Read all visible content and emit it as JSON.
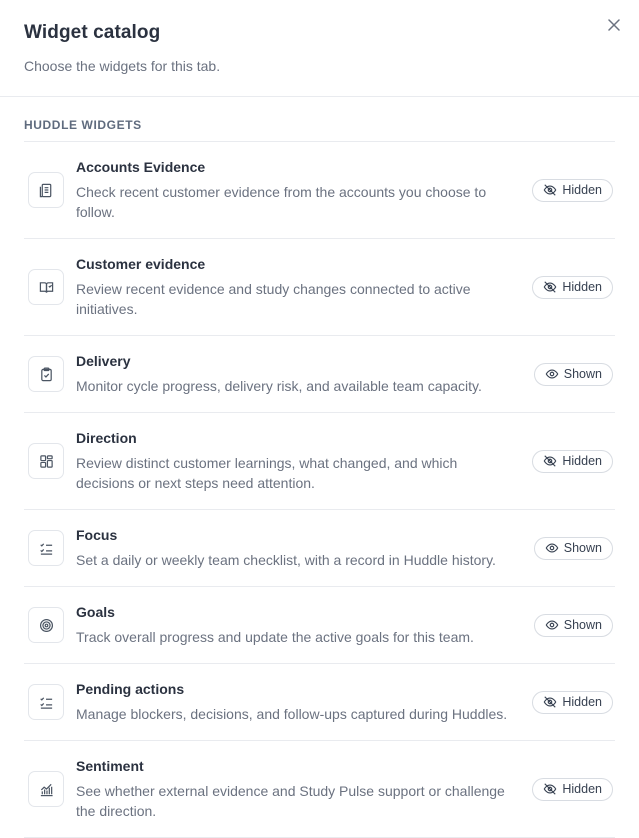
{
  "dialog": {
    "title": "Widget catalog",
    "subtitle": "Choose the widgets for this tab."
  },
  "section": {
    "title": "HUDDLE WIDGETS"
  },
  "widgets": [
    {
      "title": "Accounts Evidence",
      "description": "Check recent customer evidence from the accounts you choose to follow.",
      "status": "Hidden",
      "icon": "document-list-icon"
    },
    {
      "title": "Customer evidence",
      "description": "Review recent evidence and study changes connected to active initiatives.",
      "status": "Hidden",
      "icon": "open-book-icon"
    },
    {
      "title": "Delivery",
      "description": "Monitor cycle progress, delivery risk, and available team capacity.",
      "status": "Shown",
      "icon": "clipboard-check-icon"
    },
    {
      "title": "Direction",
      "description": "Review distinct customer learnings, what changed, and which decisions or next steps need attention.",
      "status": "Hidden",
      "icon": "layout-grid-icon"
    },
    {
      "title": "Focus",
      "description": "Set a daily or weekly team checklist, with a record in Huddle history.",
      "status": "Shown",
      "icon": "checklist-icon"
    },
    {
      "title": "Goals",
      "description": "Track overall progress and update the active goals for this team.",
      "status": "Shown",
      "icon": "target-icon"
    },
    {
      "title": "Pending actions",
      "description": "Manage blockers, decisions, and follow-ups captured during Huddles.",
      "status": "Hidden",
      "icon": "checklist-icon"
    },
    {
      "title": "Sentiment",
      "description": "See whether external evidence and Study Pulse support or challenge the direction.",
      "status": "Hidden",
      "icon": "bar-trend-icon"
    }
  ]
}
